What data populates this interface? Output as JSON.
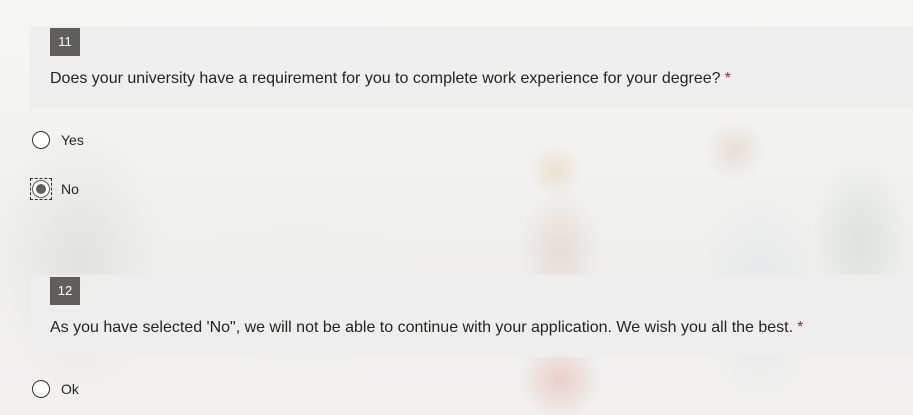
{
  "questions": [
    {
      "number": "11",
      "title": "Does your university have a requirement for you to complete work experience for your degree?",
      "required_mark": "*",
      "options": [
        {
          "label": "Yes",
          "selected": false
        },
        {
          "label": "No",
          "selected": true
        }
      ]
    },
    {
      "number": "12",
      "title": "As you have selected 'No\", we will not be able to continue with your application. We wish you all the best.",
      "required_mark": "*",
      "options": [
        {
          "label": "Ok",
          "selected": false
        }
      ]
    }
  ],
  "colors": {
    "number_badge": "#605e5c",
    "required": "#a4262c",
    "header_bg": "#eeeeee"
  }
}
